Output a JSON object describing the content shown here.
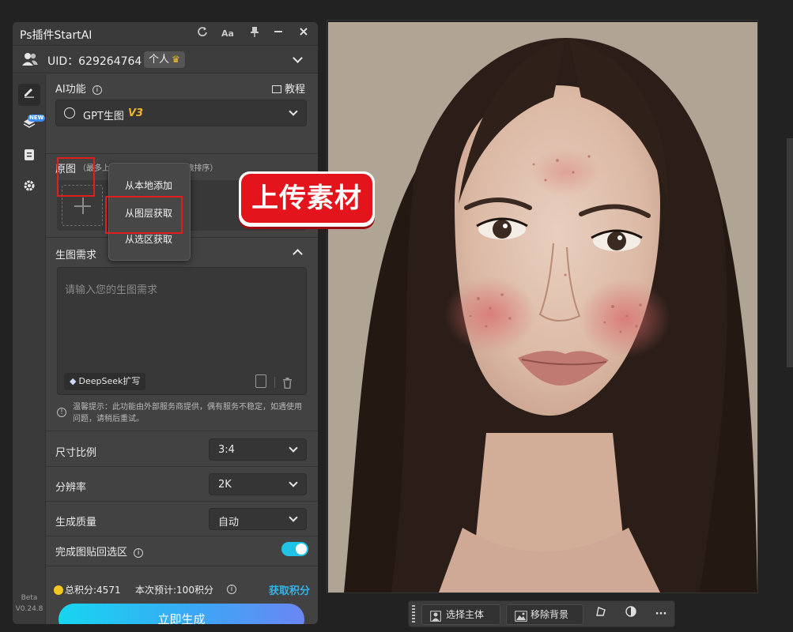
{
  "window": {
    "title": "Ps插件StartAI",
    "icons": [
      "refresh-icon",
      "font-size-icon",
      "pin-icon",
      "minimize-icon",
      "close-icon"
    ]
  },
  "user": {
    "uid_label": "UID：629264764",
    "plan_label": "个人"
  },
  "sidebar": {
    "items": [
      {
        "name": "edit",
        "icon": "pen-icon"
      },
      {
        "name": "layers",
        "icon": "layers-icon",
        "tag": "NEW"
      },
      {
        "name": "history",
        "icon": "document-icon"
      },
      {
        "name": "settings",
        "icon": "gear-icon"
      }
    ],
    "version_line1": "Beta",
    "version_line2": "V0.24.8"
  },
  "ai_function": {
    "label": "AI功能",
    "tutorial": "教程",
    "model_name": "GPT生图",
    "model_version": "V3"
  },
  "source_image": {
    "label": "原图",
    "hint": "（最多上传5张，长按图片可拖拽排序）"
  },
  "upload_menu": {
    "items": [
      "从本地添加",
      "从图层获取",
      "从选区获取"
    ]
  },
  "prompt": {
    "label": "生图需求",
    "placeholder": "请输入您的生图需求",
    "deepseek_label": "DeepSeek扩写",
    "notice": "温馨提示：此功能由外部服务商提供，偶有服务不稳定，如遇使用问题，请稍后重试。"
  },
  "settings": {
    "aspect_label": "尺寸比例",
    "aspect_value": "3:4",
    "resolution_label": "分辨率",
    "resolution_value": "2K",
    "quality_label": "生成质量",
    "quality_value": "自动",
    "paste_back_label": "完成图贴回选区",
    "paste_back_enabled": true
  },
  "footer": {
    "points_total": "总积分:4571",
    "points_estimate": "本次预计:100积分",
    "get_points": "获取积分",
    "generate_button": "立即生成"
  },
  "annotation": {
    "banner_text": "上传素材"
  },
  "canvas_toolbar": {
    "select_subject": "选择主体",
    "remove_background": "移除背景"
  },
  "colors": {
    "accent": "#20c3e6",
    "get_points": "#31b4e8",
    "highlight_box": "#e11d1d",
    "model_version": "#f0b429"
  }
}
